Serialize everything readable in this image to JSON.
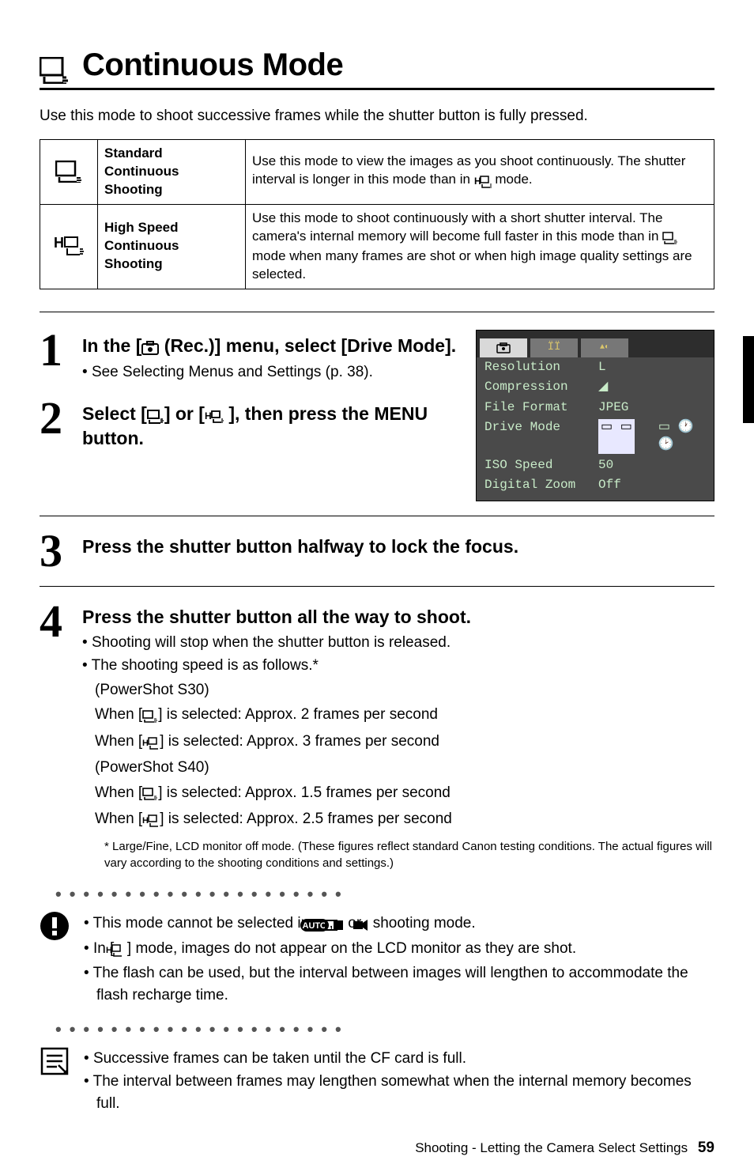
{
  "title_text": "Continuous Mode",
  "intro": "Use this mode to shoot successive frames while the shutter button is fully pressed.",
  "modes": [
    {
      "name_line1": "Standard",
      "name_line2": "Continuous Shooting",
      "desc_pre": "Use this mode to view the images as you shoot continuously. The shutter interval is longer in this mode than in ",
      "desc_post": " mode."
    },
    {
      "name_line1": "High Speed",
      "name_line2": "Continuous Shooting",
      "desc_pre": "Use this mode to shoot continuously with a short shutter interval. The camera's internal memory will become full faster in this mode than in ",
      "desc_mid": " mode when many frames are shot or when high image quality settings are selected.",
      "desc_post": ""
    }
  ],
  "steps": {
    "s1_head_pre": "In the [",
    "s1_head_mid": " (Rec.)] menu, select [Drive Mode].",
    "s1_bullet": "See Selecting Menus and Settings (p. 38).",
    "s2_head_pre": "Select [",
    "s2_head_mid": "] or [",
    "s2_head_mid2": " ], then press the ",
    "s2_head_menu": "MENU",
    "s2_head_post": " button.",
    "s3_head": "Press the shutter button halfway to lock the focus.",
    "s4_head": "Press the shutter button all the way to shoot.",
    "s4_b1": "Shooting will stop when the shutter button is released.",
    "s4_b2": "The shooting speed is as follows.*",
    "s4_model_a": "(PowerShot S30)",
    "s4_a1_pre": "When [",
    "s4_a1_post": "] is selected:  Approx. 2 frames per second",
    "s4_a2_pre": "When [",
    "s4_a2_post": "] is selected:  Approx. 3 frames per second",
    "s4_model_b": "(PowerShot S40)",
    "s4_b1x_pre": "When [",
    "s4_b1x_post": "] is selected:  Approx. 1.5 frames per second",
    "s4_b2x_pre": "When [",
    "s4_b2x_post": "] is selected:  Approx. 2.5 frames per second",
    "s4_footnote": "* Large/Fine, LCD monitor off mode. (These figures reflect standard Canon testing conditions. The actual figures will vary according to the shooting conditions and settings.)"
  },
  "notes_warn": {
    "n1_pre": "This mode cannot be selected in ",
    "n1_post": " shooting mode.",
    "n2_pre": "In [ ",
    "n2_post": " ] mode, images do not appear on the LCD monitor as they are shot.",
    "n3": "The flash can be used, but the interval between images will lengthen to accommodate the flash recharge time."
  },
  "notes_tip": {
    "t1": "Successive frames can be taken until the CF card is full.",
    "t2": "The interval between frames may lengthen somewhat when the internal memory becomes full."
  },
  "menu_panel": {
    "rows": [
      {
        "k": "Resolution",
        "v": "L"
      },
      {
        "k": "Compression",
        "v": "◢"
      },
      {
        "k": "File Format",
        "v": "JPEG"
      },
      {
        "k": "Drive Mode",
        "v": "▭ ▭ ▭ 🕐 🕑",
        "selected": true
      },
      {
        "k": "ISO Speed",
        "v": "50"
      },
      {
        "k": "Digital Zoom",
        "v": "Off"
      }
    ]
  },
  "footer_text": "Shooting - Letting the Camera Select Settings",
  "footer_page": "59"
}
